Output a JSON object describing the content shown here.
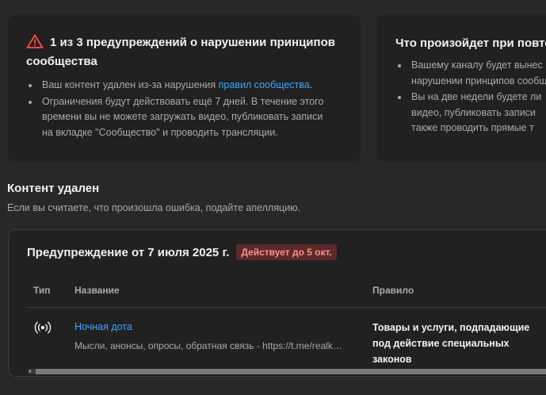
{
  "strike_card": {
    "title": "1 из 3 предупреждений о нарушении принципов сообщества",
    "icon": "warning-triangle-icon",
    "icon_color": "#ff4e45",
    "bullet1_text": "Ваш контент удален из-за нарушения ",
    "bullet1_link": "правил сообщества",
    "bullet1_end": ".",
    "bullet2_line1": "Ограничения будут действовать ещё 7 дней. В течение этого",
    "bullet2_line2": "времени вы не можете загружать видео, публиковать записи",
    "bullet2_line3": "на вкладке \"Сообщество\" и проводить трансляции."
  },
  "next_card": {
    "title": "Что произойдет при повтор",
    "bullet1_line1": "Вашему каналу будет вынес",
    "bullet1_line2": "нарушении принципов сообщ",
    "bullet2_line1": "Вы на две недели будете ли",
    "bullet2_line2": "видео, публиковать записи",
    "bullet2_line3": "также проводить прямые т"
  },
  "content_section": {
    "title": "Контент удален",
    "subtitle": "Если вы считаете, что произошла ошибка, подайте апелляцию."
  },
  "warning_panel": {
    "title": "Предупреждение от 7 июля 2025 г.",
    "badge": "Действует до 5 окт.",
    "badge_bg": "#5c2a2a",
    "badge_color": "#ff8f8f",
    "columns": {
      "type": "Тип",
      "name": "Название",
      "rule": "Правило"
    },
    "row": {
      "type_icon": "live-broadcast-icon",
      "video_title": "Ночная дота",
      "video_description": "Мысли, анонсы, опросы, обратная связь - https://t.me/realk…",
      "rule": "Товары и услуги, подпадающие под действие специальных законов"
    }
  },
  "colors": {
    "background": "#282828",
    "card": "#212121",
    "link": "#3ea6ff",
    "text_primary": "#f1f1f1",
    "text_secondary": "#aaaaaa"
  }
}
